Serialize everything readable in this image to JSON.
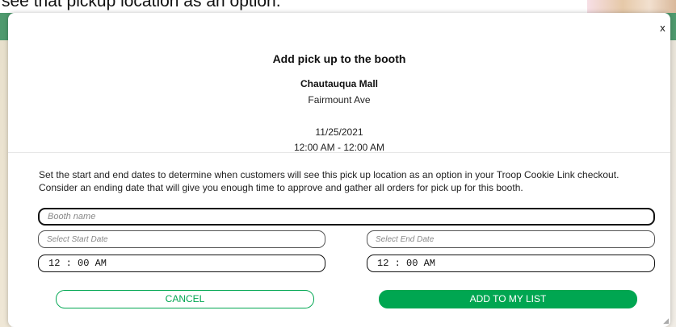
{
  "background": {
    "partial_text": "see that pickup location as an option."
  },
  "modal": {
    "close_label": "x",
    "title": "Add pick up to the booth",
    "location_name": "Chautauqua Mall",
    "location_street": "Fairmount Ave",
    "date": "11/25/2021",
    "time_range": "12:00 AM - 12:00 AM",
    "description": "Set the start and end dates to determine when customers will see this pick up location as an option in your Troop Cookie Link checkout. Consider an ending date that will give you enough time to approve and gather all orders for pick up for this booth.",
    "booth_name_placeholder": "Booth name",
    "start_date_placeholder": "Select Start Date",
    "end_date_placeholder": "Select End Date",
    "start_time": "12 : 00  AM",
    "end_time": "12 : 00  AM",
    "cancel_label": "CANCEL",
    "add_label": "ADD TO MY LIST"
  },
  "colors": {
    "accent": "#00a651",
    "background_green": "#4f9a6e"
  }
}
